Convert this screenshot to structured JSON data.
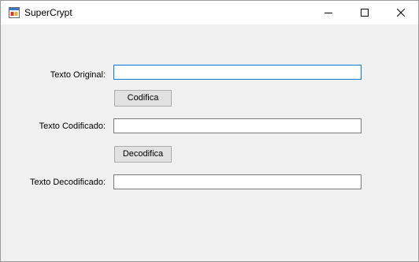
{
  "window": {
    "title": "SuperCrypt",
    "app_icon": "app-window-icon",
    "controls": {
      "minimize_icon": "minimize-icon",
      "maximize_icon": "maximize-icon",
      "close_icon": "close-icon"
    }
  },
  "form": {
    "original": {
      "label": "Texto Original:",
      "value": ""
    },
    "encode_button": {
      "label": "Codifica"
    },
    "encoded": {
      "label": "Texto Codificado:",
      "value": ""
    },
    "decode_button": {
      "label": "Decodifica"
    },
    "decoded": {
      "label": "Texto Decodificado:",
      "value": ""
    }
  },
  "colors": {
    "focus_border": "#0078d7",
    "window_bg": "#f0f0f0",
    "button_bg": "#e1e1e1"
  }
}
